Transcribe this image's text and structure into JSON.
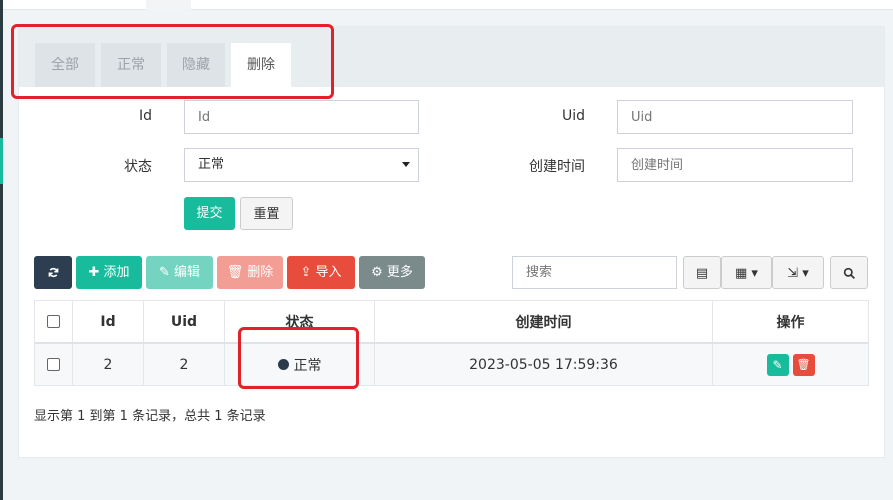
{
  "tabs": [
    {
      "label": "全部"
    },
    {
      "label": "正常"
    },
    {
      "label": "隐藏"
    },
    {
      "label": "删除"
    }
  ],
  "search_form": {
    "id_label": "Id",
    "id_placeholder": "Id",
    "uid_label": "Uid",
    "uid_placeholder": "Uid",
    "status_label": "状态",
    "status_value": "正常",
    "created_label": "创建时间",
    "created_placeholder": "创建时间",
    "submit_label": "提交",
    "reset_label": "重置"
  },
  "toolbar": {
    "add_label": "添加",
    "edit_label": "编辑",
    "delete_label": "删除",
    "import_label": "导入",
    "more_label": "更多",
    "search_placeholder": "搜索"
  },
  "table": {
    "columns": [
      "Id",
      "Uid",
      "状态",
      "创建时间",
      "操作"
    ],
    "rows": [
      {
        "id": "2",
        "uid": "2",
        "status": "正常",
        "created": "2023-05-05 17:59:36"
      }
    ]
  },
  "pagination_text": "显示第 1 到第 1 条记录，总共 1 条记录",
  "colors": {
    "primary": "#18bc9c",
    "danger": "#e74c3c",
    "dark": "#2c3e50",
    "gray": "#95a5a6",
    "highlight": "#e2222b"
  }
}
